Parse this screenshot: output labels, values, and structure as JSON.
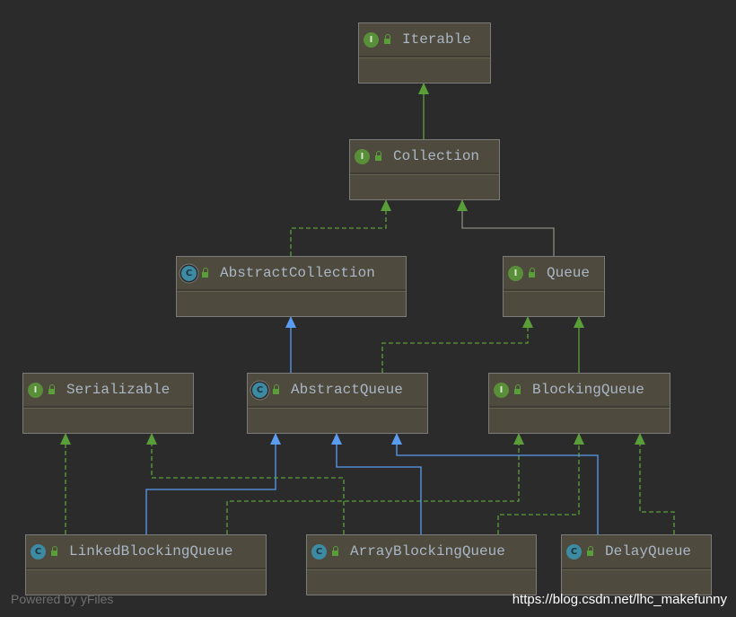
{
  "colors": {
    "background": "#2b2b2b",
    "node": "#4f4a3e",
    "interface_edge": "#5a9e3a",
    "class_edge": "#5a9cf0",
    "text": "#a9b7c6"
  },
  "nodes": [
    {
      "id": "Iterable",
      "label": "Iterable",
      "kind": "interface"
    },
    {
      "id": "Collection",
      "label": "Collection",
      "kind": "interface"
    },
    {
      "id": "AbstractCollection",
      "label": "AbstractCollection",
      "kind": "abstract-class"
    },
    {
      "id": "Queue",
      "label": "Queue",
      "kind": "interface"
    },
    {
      "id": "Serializable",
      "label": "Serializable",
      "kind": "interface"
    },
    {
      "id": "AbstractQueue",
      "label": "AbstractQueue",
      "kind": "abstract-class"
    },
    {
      "id": "BlockingQueue",
      "label": "BlockingQueue",
      "kind": "interface"
    },
    {
      "id": "LinkedBlockingQueue",
      "label": "LinkedBlockingQueue",
      "kind": "class"
    },
    {
      "id": "ArrayBlockingQueue",
      "label": "ArrayBlockingQueue",
      "kind": "class"
    },
    {
      "id": "DelayQueue",
      "label": "DelayQueue",
      "kind": "class"
    }
  ],
  "edges": [
    {
      "from": "Collection",
      "to": "Iterable",
      "type": "extends-interface"
    },
    {
      "from": "AbstractCollection",
      "to": "Collection",
      "type": "implements"
    },
    {
      "from": "Queue",
      "to": "Collection",
      "type": "extends-interface"
    },
    {
      "from": "AbstractQueue",
      "to": "AbstractCollection",
      "type": "extends-class"
    },
    {
      "from": "AbstractQueue",
      "to": "Queue",
      "type": "implements"
    },
    {
      "from": "BlockingQueue",
      "to": "Queue",
      "type": "extends-interface"
    },
    {
      "from": "LinkedBlockingQueue",
      "to": "Serializable",
      "type": "implements"
    },
    {
      "from": "LinkedBlockingQueue",
      "to": "AbstractQueue",
      "type": "extends-class"
    },
    {
      "from": "LinkedBlockingQueue",
      "to": "BlockingQueue",
      "type": "implements"
    },
    {
      "from": "ArrayBlockingQueue",
      "to": "Serializable",
      "type": "implements"
    },
    {
      "from": "ArrayBlockingQueue",
      "to": "AbstractQueue",
      "type": "extends-class"
    },
    {
      "from": "ArrayBlockingQueue",
      "to": "BlockingQueue",
      "type": "implements"
    },
    {
      "from": "DelayQueue",
      "to": "AbstractQueue",
      "type": "extends-class"
    },
    {
      "from": "DelayQueue",
      "to": "BlockingQueue",
      "type": "implements"
    }
  ],
  "badges": {
    "interface": "I",
    "class": "C"
  },
  "footer": {
    "powered_by": "Powered by yFiles",
    "watermark": "https://blog.csdn.net/lhc_makefunny"
  }
}
